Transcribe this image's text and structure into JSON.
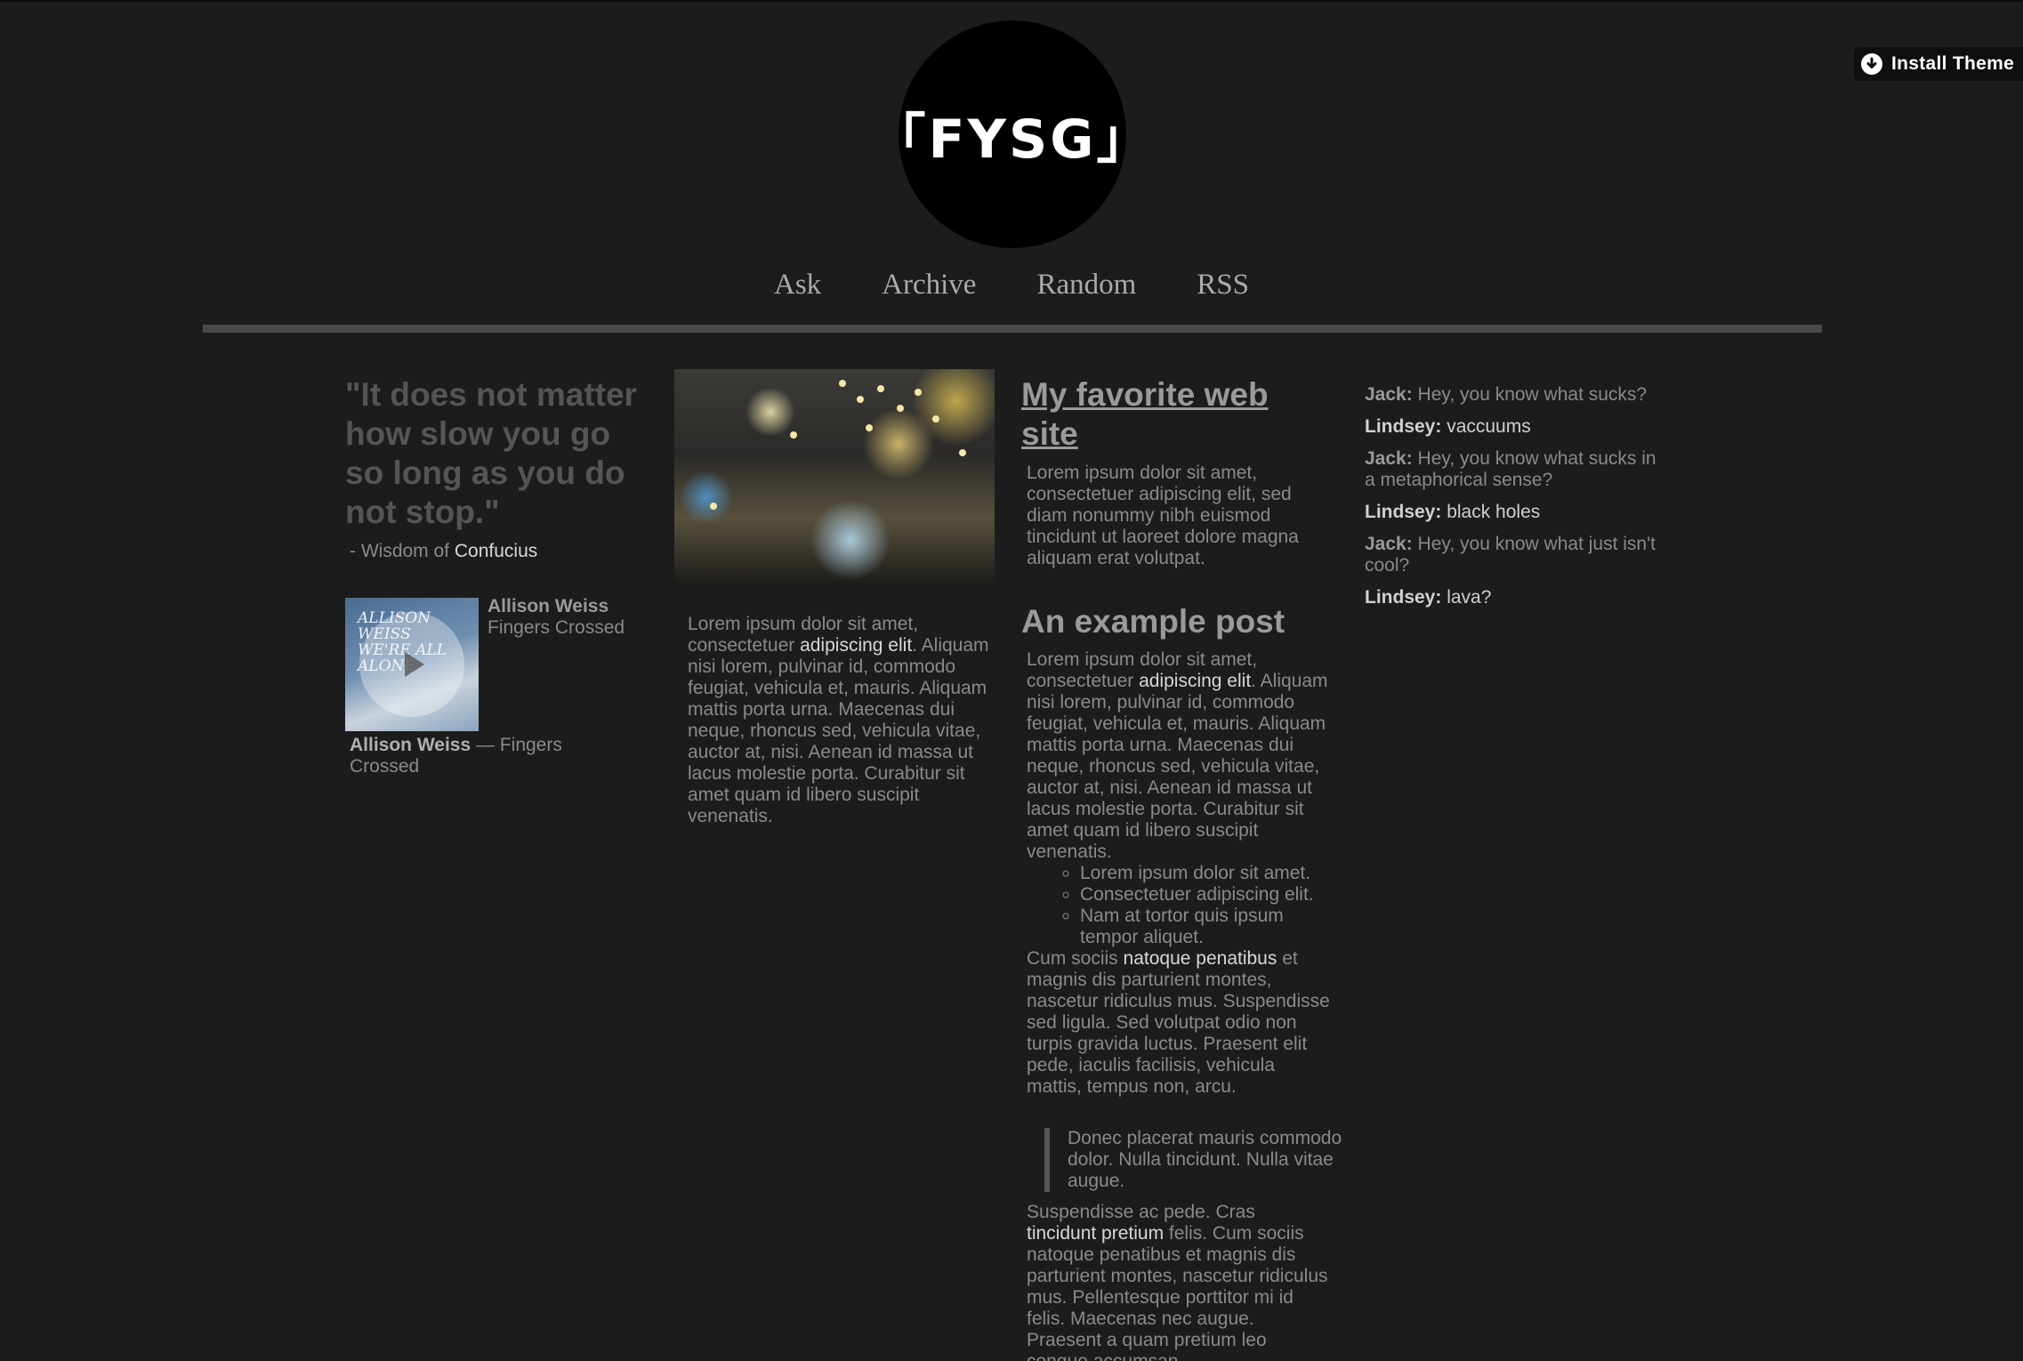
{
  "install_theme": {
    "label": "Install Theme",
    "icon": "download-circle-icon"
  },
  "logo": {
    "text": "「FYSG」"
  },
  "nav": {
    "items": [
      "Ask",
      "Archive",
      "Random",
      "RSS"
    ]
  },
  "quote_post": {
    "quote": "\"It does not matter how slow you go so long as you do not stop.\"",
    "source_prefix": "- Wisdom of ",
    "source_name": "Confucius"
  },
  "audio_post": {
    "artist": "Allison Weiss",
    "track": "Fingers Crossed",
    "art_text": "ALLISON WEISS\nWE'RE ALL ALONE",
    "caption_artist": "Allison Weiss",
    "caption_rest": " — Fingers Crossed"
  },
  "photo_post": {
    "caption_parts": [
      "Lorem ipsum dolor sit amet, consectetuer ",
      "adipiscing elit",
      ". Aliquam nisi lorem, pulvinar id, commodo feugiat, vehicula et, mauris. Aliquam mattis porta urna. Maecenas dui neque, rhoncus sed, vehicula vitae, auctor at, nisi. Aenean id massa ut lacus molestie porta. Curabitur sit amet quam id libero suscipit venenatis."
    ]
  },
  "link_post": {
    "title": "My favorite web site",
    "body": "Lorem ipsum dolor sit amet, consectetuer adipiscing elit, sed diam nonummy nibh euismod tincidunt ut laoreet dolore magna aliquam erat volutpat."
  },
  "text_post": {
    "title": "An example post",
    "p1_parts": [
      "Lorem ipsum dolor sit amet, consectetuer ",
      "adipiscing elit",
      ". Aliquam nisi lorem, pulvinar id, commodo feugiat, vehicula et, mauris. Aliquam mattis porta urna. Maecenas dui neque, rhoncus sed, vehicula vitae, auctor at, nisi. Aenean id massa ut lacus molestie porta. Curabitur sit amet quam id libero suscipit venenatis."
    ],
    "list": [
      "Lorem ipsum dolor sit amet.",
      "Consectetuer adipiscing elit.",
      "Nam at tortor quis ipsum tempor aliquet."
    ],
    "p2_parts": [
      "Cum sociis ",
      "natoque penatibus",
      " et magnis dis parturient montes, nascetur ridiculus mus. Suspendisse sed ligula. Sed volutpat odio non turpis gravida luctus. Praesent elit pede, iaculis facilisis, vehicula mattis, tempus non, arcu."
    ],
    "blockquote": "Donec placerat mauris commodo dolor. Nulla tincidunt. Nulla vitae augue.",
    "p3_parts": [
      "Suspendisse ac pede. Cras ",
      "tincidunt pretium",
      " felis. Cum sociis natoque penatibus et magnis dis parturient montes, nascetur ridiculus mus. Pellentesque porttitor mi id felis. Maecenas nec augue. Praesent a quam pretium leo congue accumsan."
    ]
  },
  "chat_post": {
    "lines": [
      {
        "speaker": "Jack:",
        "msg": " Hey, you know what sucks?"
      },
      {
        "speaker": "Lindsey:",
        "msg": " vaccuums"
      },
      {
        "speaker": "Jack:",
        "msg": " Hey, you know what sucks in a metaphorical sense?"
      },
      {
        "speaker": "Lindsey:",
        "msg": " black holes"
      },
      {
        "speaker": "Jack:",
        "msg": " Hey, you know what just isn't cool?"
      },
      {
        "speaker": "Lindsey:",
        "msg": " lava?"
      }
    ]
  }
}
